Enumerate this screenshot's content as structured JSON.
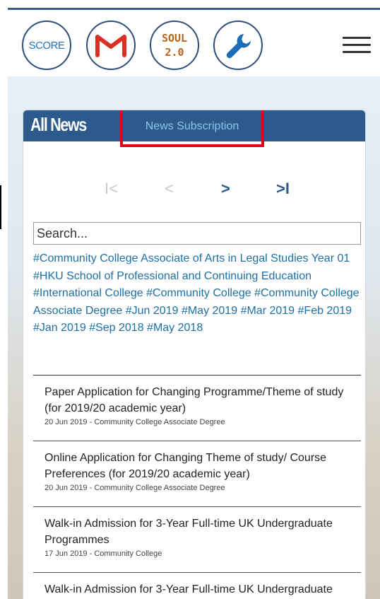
{
  "header": {
    "score_label": "SCORE",
    "soul_line1": "SOUL",
    "soul_line2": "2.0"
  },
  "panel": {
    "title": "All News",
    "subscription_tab": "News Subscription"
  },
  "pager": {
    "first": "I<",
    "prev": "<",
    "next": ">",
    "last": ">I"
  },
  "search": {
    "placeholder": "Search..."
  },
  "tags": [
    "#Community College Associate of Arts in Legal Studies Year 01",
    "#HKU School of Professional and Continuing Education",
    "#International College",
    "#Community College",
    "#Community College Associate Degree",
    "#Jun 2019",
    "#May 2019",
    "#Mar 2019",
    "#Feb 2019",
    "#Jan 2019",
    "#Sep 2018",
    "#May 2018"
  ],
  "news": [
    {
      "title": "Paper Application for Changing Programme/Theme of study (for 2019/20 academic year)",
      "meta": "20 Jun 2019 - Community College Associate Degree"
    },
    {
      "title": "Online Application for Changing Theme of study/ Course Preferences (for 2019/20 academic year)",
      "meta": "20 Jun 2019 - Community College Associate Degree"
    },
    {
      "title": "Walk-in Admission for 3-Year Full-time UK Undergraduate Programmes",
      "meta": "17 Jun 2019 - Community College"
    },
    {
      "title": "Walk-in Admission for 3-Year Full-time UK Undergraduate",
      "meta": ""
    }
  ],
  "colors": {
    "brand": "#2c5a8c",
    "link": "#1d6fa5",
    "highlight": "#e3001b",
    "gmail_red": "#d93025"
  }
}
